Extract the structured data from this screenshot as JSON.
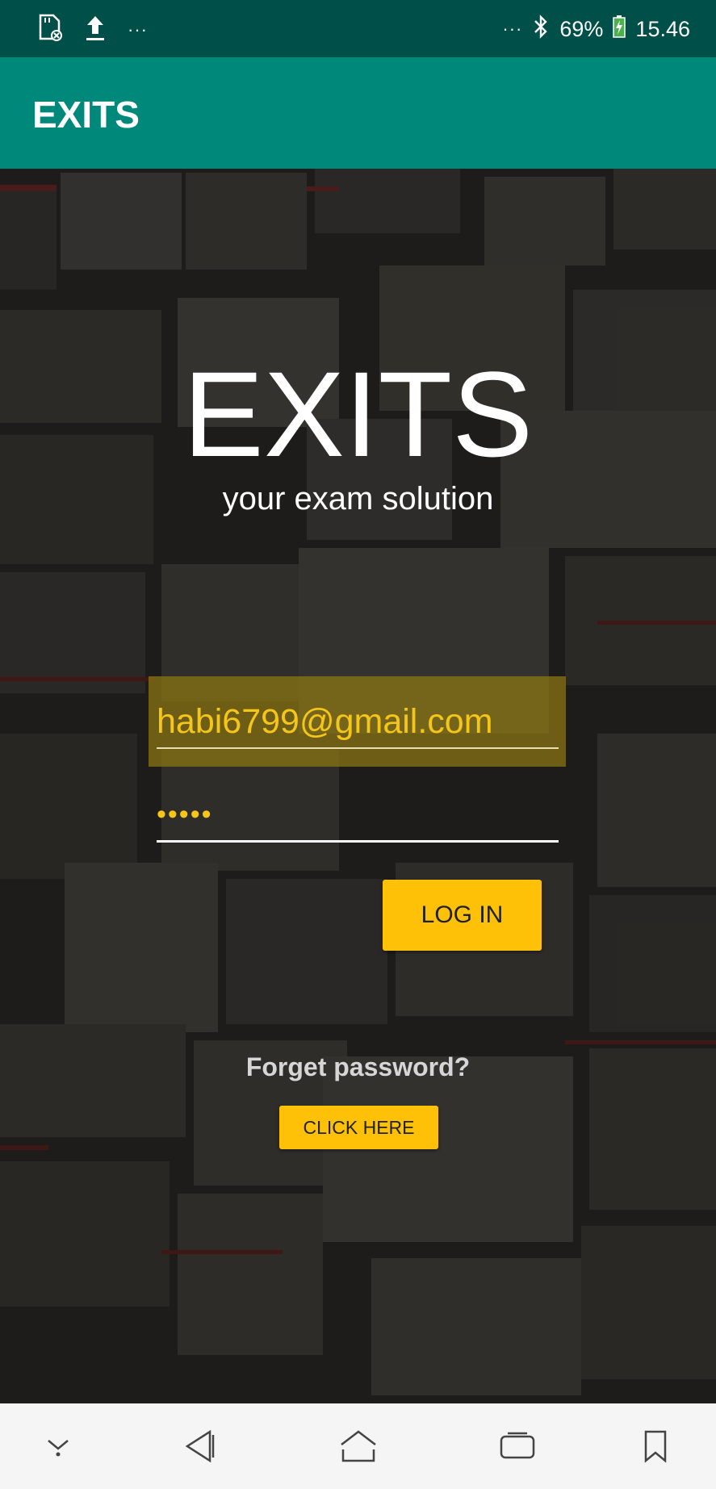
{
  "status_bar": {
    "left_dots": "···",
    "right_dots": "···",
    "battery_percent": "69%",
    "time": "15.46"
  },
  "app_bar": {
    "title": "EXITS"
  },
  "logo": {
    "title": "EXITS",
    "subtitle": "your exam solution"
  },
  "login_form": {
    "email_value": "habi6799@gmail.com",
    "password_masked": "•••••",
    "login_label": "LOG IN"
  },
  "forgot": {
    "text": "Forget password?",
    "button_label": "CLICK HERE"
  },
  "colors": {
    "status_bar": "#004f49",
    "app_bar": "#00897b",
    "accent": "#ffc107",
    "input_text": "#f5c518"
  },
  "nav_bar": {
    "icons": [
      "chevron-down-icon",
      "back-icon",
      "home-icon",
      "recents-icon",
      "bookmark-icon"
    ]
  }
}
